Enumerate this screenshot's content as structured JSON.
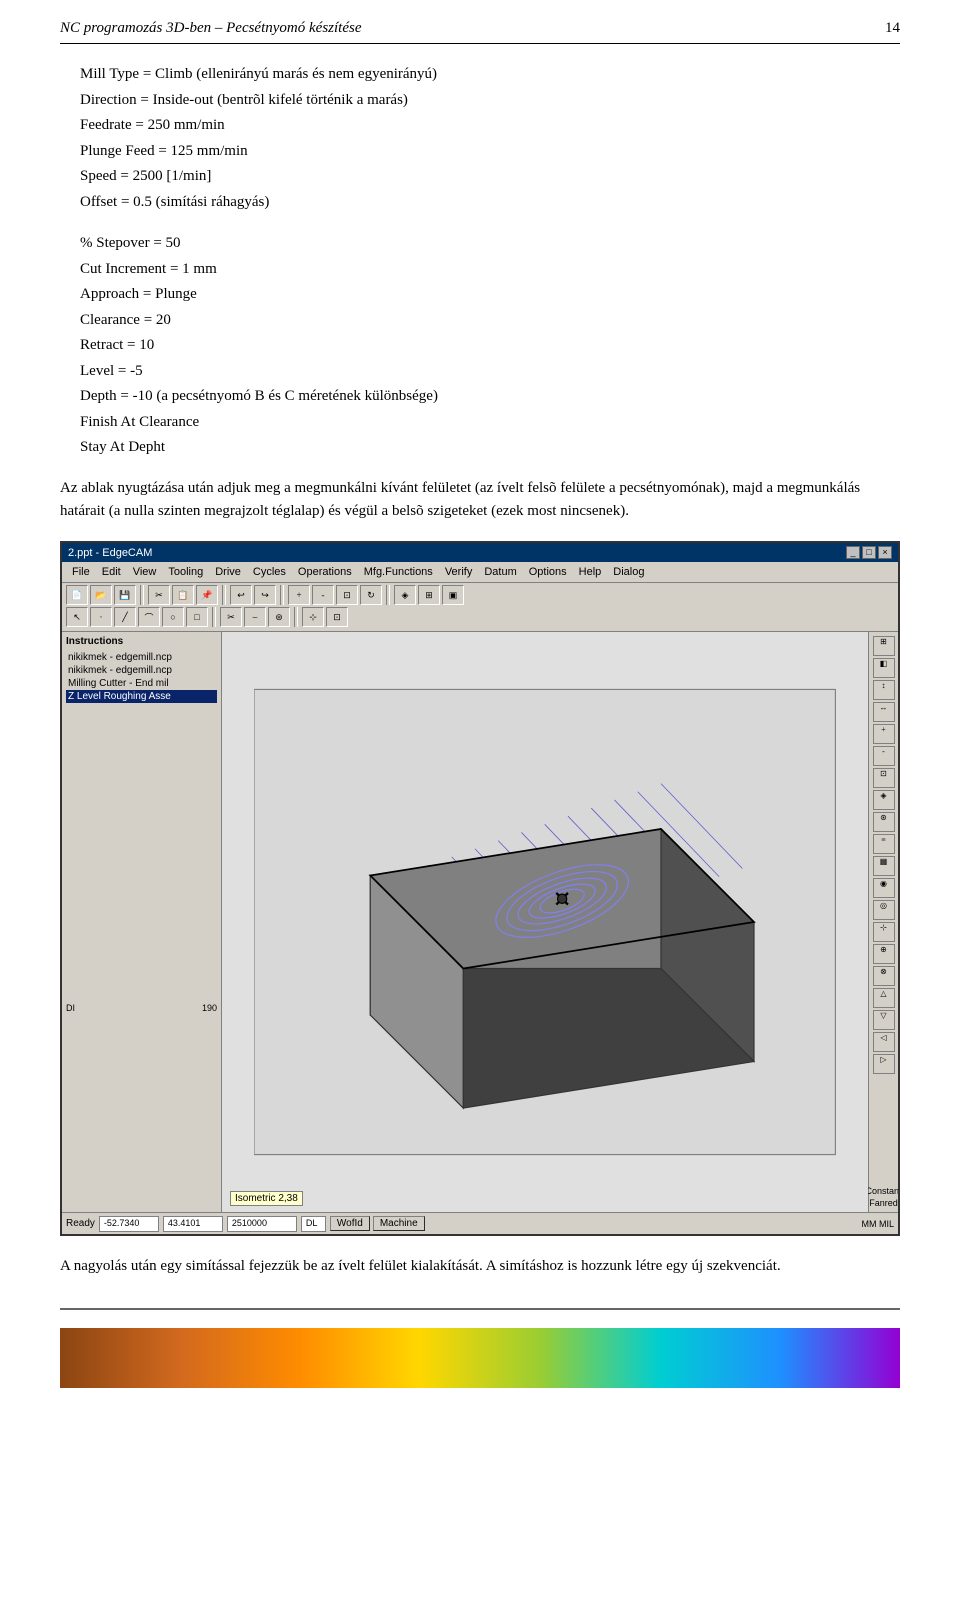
{
  "header": {
    "title": "NC programozás 3D-ben – Pecsétnyomó készítése",
    "page_number": "14"
  },
  "intro_text": "Az ablak nyugtázása után adjuk meg a megmunkálni kívánt felületet (az ívelt felsõ felülete a pecsétnyomónak), majd a megmunkálás határait (a nulla szinten megrajzolt téglalap) és végül a belsõ szigeteket (ezek most nincsenek).",
  "section1": {
    "lines": [
      "Mill Type = Climb (ellenirányú marás és nem egyenirányú)",
      "Direction = Inside-out (bentrõl kifelé történik a marás)",
      "Feedrate = 250 mm/min",
      "Plunge Feed = 125 mm/min",
      "Speed = 2500 [1/min]",
      "Offset = 0.5 (simítási ráhagyás)"
    ]
  },
  "section2": {
    "lines": [
      "% Stepover = 50",
      "Cut Increment = 1 mm",
      "Approach = Plunge",
      "Clearance = 20",
      "Retract = 10",
      "Level = -5",
      "Depth = -10 (a pecsétnyomó B és C méretének különbsége)",
      "Finish At Clearance",
      "Stay At Depht"
    ]
  },
  "edgecam": {
    "title": "2.ppt - EdgeCAM",
    "menu_items": [
      "File",
      "Edit",
      "View",
      "Tooling",
      "Drive",
      "Cycles",
      "Operations",
      "Mfg.Functions",
      "Verify",
      "Datum",
      "Options",
      "Help",
      "Dialog"
    ],
    "left_panel": {
      "title": "Instructions",
      "items": [
        "nikikmek - edgemill.ncp",
        "nikikmek - edgemill.ncp",
        "Milling Cutter - End mil",
        "Z Level Roughing Asse"
      ]
    },
    "viewport_label": "Isometric 2,38",
    "status_fields": [
      "-52.7340",
      "43.4101",
      "2510000",
      "DL",
      "WofId",
      "Machine"
    ]
  },
  "bottom_text1": "A nagyolás után egy simítással fejezzük be az ívelt felület kialakítását. A simításhoz is hozzunk létre egy új szekvenciát.",
  "footer": {
    "gradient_colors": [
      "#8B4513",
      "#D2691E",
      "#FF8C00",
      "#FFD700",
      "#9ACD32",
      "#00CED1",
      "#1E90FF",
      "#9400D3"
    ]
  }
}
